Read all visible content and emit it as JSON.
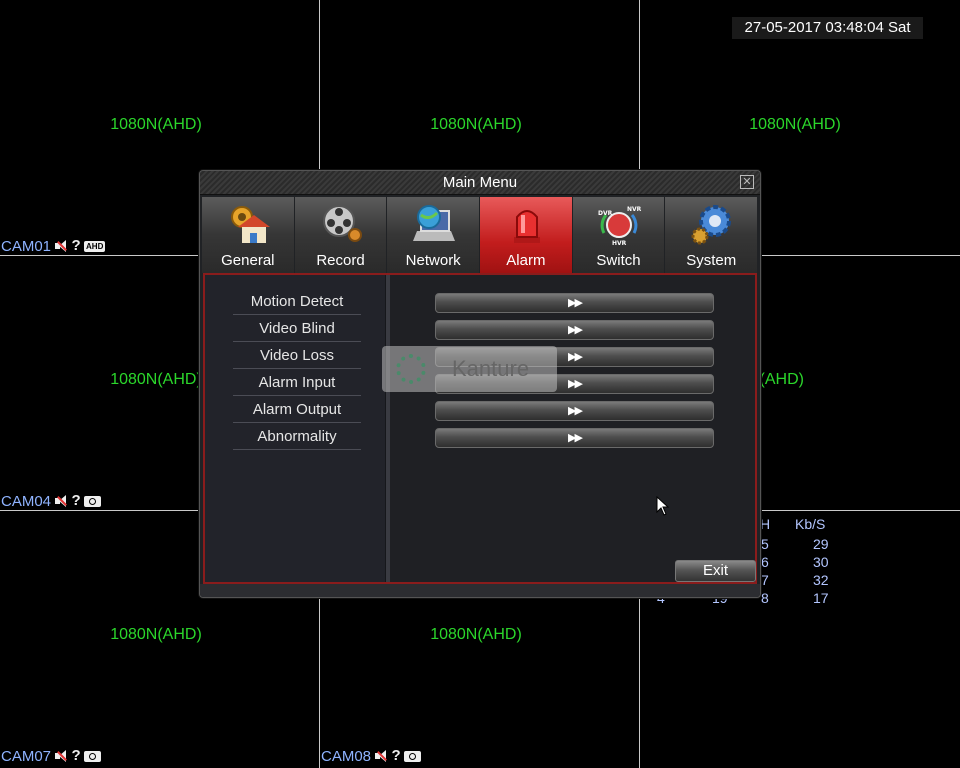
{
  "datetime": "27-05-2017 03:48:04 Sat",
  "channels": {
    "resolution": "1080N(AHD)",
    "cam01": "CAM01",
    "cam04": "CAM04",
    "cam07": "CAM07",
    "cam08": "CAM08",
    "ahd_badge": "AHD"
  },
  "stats": {
    "header_ch": "H",
    "header_kbs": "Kb/S",
    "rows": [
      {
        "ch": "5",
        "kbs": "29"
      },
      {
        "ch": "6",
        "kbs": "30"
      },
      {
        "ch": "7",
        "kbs": "32"
      },
      {
        "ch": "8",
        "kbs": "17"
      }
    ],
    "partial_left": "4",
    "partial_mid": "19"
  },
  "dialog": {
    "title": "Main Menu",
    "close_glyph": "✕",
    "tabs": [
      {
        "label": "General",
        "icon": "house-gear-icon"
      },
      {
        "label": "Record",
        "icon": "film-reel-icon"
      },
      {
        "label": "Network",
        "icon": "globe-laptop-icon"
      },
      {
        "label": "Alarm",
        "icon": "siren-icon",
        "active": true
      },
      {
        "label": "Switch",
        "icon": "dvr-nvr-switch-icon",
        "sub": [
          "DVR",
          "NVR",
          "HVR"
        ]
      },
      {
        "label": "System",
        "icon": "gears-icon"
      }
    ],
    "menu": [
      "Motion Detect",
      "Video Blind",
      "Video Loss",
      "Alarm Input",
      "Alarm Output",
      "Abnormality"
    ],
    "row_button_glyph": "▶▶",
    "exit_label": "Exit"
  },
  "watermark": "Kanture",
  "colors": {
    "accent_active_tab": "#c21d1d",
    "panel_border": "#8a1c1c",
    "resolution_text": "#2bd62b",
    "cam_label": "#8fb3ff"
  }
}
